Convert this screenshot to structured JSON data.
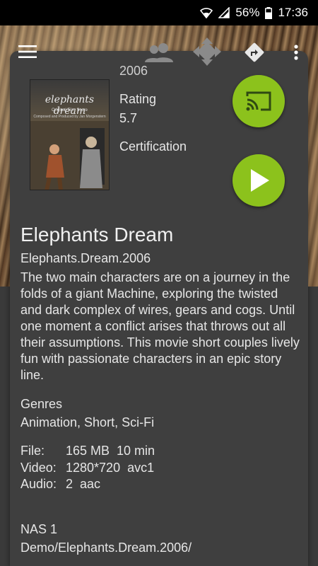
{
  "status_bar": {
    "battery": "56%",
    "time": "17:36"
  },
  "toolbar": {
    "menu_icon": "hamburger-menu-icon",
    "cast_group_icon": "people-icon",
    "move_icon": "move-arrows-icon",
    "directions_icon": "directions-icon",
    "overflow_icon": "more-vert-icon"
  },
  "movie": {
    "year": "2006",
    "poster": {
      "title": "elephants dream",
      "subtitle": "Original Film Score",
      "credit": "Composed and Produced by Jan Morgenstern"
    },
    "rating_label": "Rating",
    "rating_value": "5.7",
    "certification_label": "Certification",
    "title": "Elephants Dream",
    "file_name": "Elephants.Dream.2006",
    "plot": "The two main characters are on a journey in the folds of a giant Machine, exploring the twisted and dark complex of wires, gears and cogs. Until one moment a conflict arises that throws out all their assumptions. This movie short couples lively fun with passionate characters in an epic story line.",
    "genres_label": "Genres",
    "genres": "Animation, Short, Sci-Fi",
    "file_label": "File:",
    "file_value": "165 MB  10 min",
    "video_label": "Video:",
    "video_value": "1280*720  avc1",
    "audio_label": "Audio:",
    "audio_value": "2  aac",
    "source_name": "NAS 1",
    "source_path": "Demo/Elephants.Dream.2006/"
  },
  "actions": {
    "cast_button_icon": "cast-icon",
    "play_button_icon": "play-icon",
    "accent": "#8cc21c"
  }
}
